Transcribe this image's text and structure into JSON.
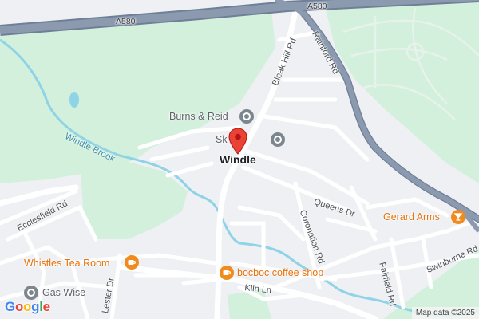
{
  "map": {
    "place_name": "Windle",
    "colors": {
      "land": "#eef0f3",
      "park": "#d2f0dc",
      "water": "#8fd3e6",
      "road": "#ffffff",
      "highway": "#8c9ab0",
      "highway_edge": "#6f7f97",
      "pin": "#ea4335",
      "poi_orange": "#e8710a",
      "poi_grey": "#7c868f"
    },
    "highways": [
      {
        "id": "a580-west",
        "label": "A580"
      },
      {
        "id": "a580-east",
        "label": "A580"
      }
    ],
    "roads": [
      {
        "id": "bleak-hill-rd",
        "label": "Bleak Hill Rd"
      },
      {
        "id": "rainford-rd",
        "label": "Rainford Rd"
      },
      {
        "id": "ecclesfield-rd",
        "label": "Ecclesfield Rd"
      },
      {
        "id": "queens-dr",
        "label": "Queens Dr"
      },
      {
        "id": "coronation-rd",
        "label": "Coronation Rd"
      },
      {
        "id": "lester-dr",
        "label": "Lester Dr"
      },
      {
        "id": "kiln-ln",
        "label": "Kiln Ln"
      },
      {
        "id": "fairfield-rd",
        "label": "Fairfield Rd"
      },
      {
        "id": "swinburne-rd",
        "label": "Swinburne Rd"
      }
    ],
    "water": [
      {
        "id": "windle-brook",
        "label": "Windle Brook"
      }
    ],
    "pois": [
      {
        "id": "burns-reid",
        "label": "Burns & Reid",
        "icon": "shop-icon",
        "color": "#7c868f"
      },
      {
        "id": "sk31",
        "label": "Sk    31",
        "icon": "shop-icon",
        "color": "#7c868f"
      },
      {
        "id": "gerard-arms",
        "label": "Gerard Arms",
        "icon": "cocktail-icon",
        "color": "#f28b1e"
      },
      {
        "id": "whistles-tea-room",
        "label": "Whistles Tea Room",
        "icon": "cafe-icon",
        "color": "#f28b1e"
      },
      {
        "id": "bocboc-coffee",
        "label": "bocboc coffee shop",
        "icon": "cafe-icon",
        "color": "#f28b1e"
      },
      {
        "id": "gas-wise",
        "label": "Gas Wise",
        "icon": "shop-icon",
        "color": "#7c868f"
      }
    ],
    "logo": "Google",
    "attribution": "Map data ©2025"
  }
}
